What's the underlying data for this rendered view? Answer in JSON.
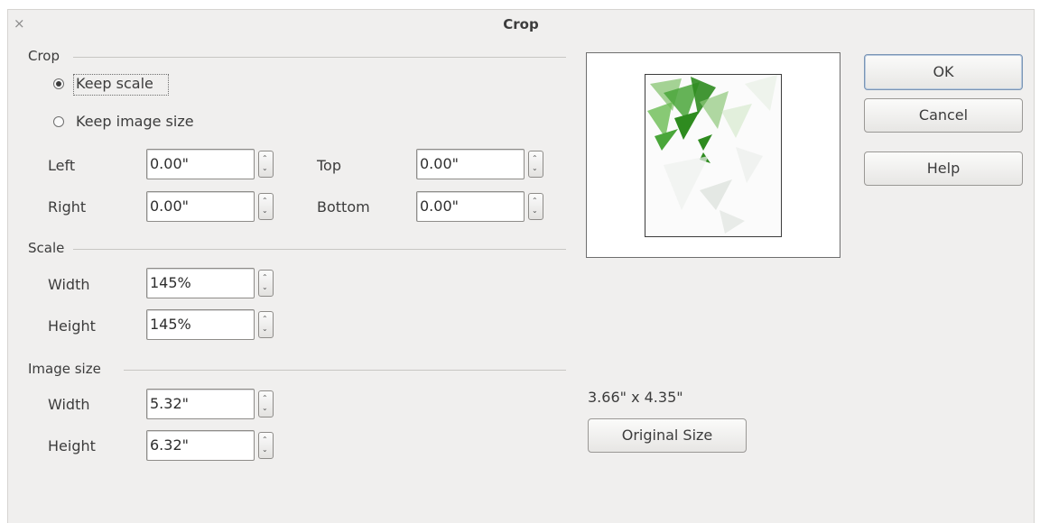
{
  "dialog": {
    "title": "Crop",
    "close_symbol": "×"
  },
  "crop": {
    "heading": "Crop",
    "keep_scale": "Keep scale",
    "keep_image_size": "Keep image size",
    "selected": "keep_scale",
    "left_label": "Left",
    "left_value": "0.00\"",
    "right_label": "Right",
    "right_value": "0.00\"",
    "top_label": "Top",
    "top_value": "0.00\"",
    "bottom_label": "Bottom",
    "bottom_value": "0.00\""
  },
  "scale": {
    "heading": "Scale",
    "width_label": "Width",
    "width_value": "145%",
    "height_label": "Height",
    "height_value": "145%"
  },
  "image_size": {
    "heading": "Image size",
    "width_label": "Width",
    "width_value": "5.32\"",
    "height_label": "Height",
    "height_value": "6.32\""
  },
  "original": {
    "size_text": "3.66\" x 4.35\"",
    "button": "Original Size"
  },
  "buttons": {
    "ok": "OK",
    "cancel": "Cancel",
    "help": "Help"
  },
  "colors": {
    "leaf_dark": "#2e8b1f",
    "leaf_light": "#8fc87a",
    "default_border": "#7a95b5"
  }
}
